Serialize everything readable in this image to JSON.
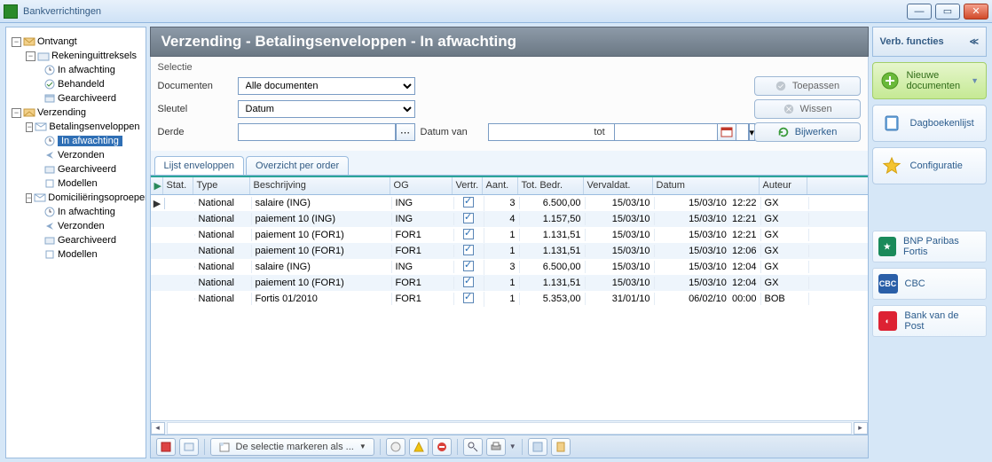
{
  "window": {
    "title": "Bankverrichtingen"
  },
  "tree": {
    "root1": {
      "label": "Ontvangt"
    },
    "r1_c1": {
      "label": "Rekeninguittreksels"
    },
    "r1_c1_a": {
      "label": "In afwachting"
    },
    "r1_c1_b": {
      "label": "Behandeld"
    },
    "r1_c1_c": {
      "label": "Gearchiveerd"
    },
    "root2": {
      "label": "Verzending"
    },
    "r2_c1": {
      "label": "Betalingsenveloppen"
    },
    "r2_c1_a": {
      "label": "In afwachting"
    },
    "r2_c1_b": {
      "label": "Verzonden"
    },
    "r2_c1_c": {
      "label": "Gearchiveerd"
    },
    "r2_c1_d": {
      "label": "Modellen"
    },
    "r2_c2": {
      "label": "Domiciliëringsoproepen"
    },
    "r2_c2_a": {
      "label": "In afwachting"
    },
    "r2_c2_b": {
      "label": "Verzonden"
    },
    "r2_c2_c": {
      "label": "Gearchiveerd"
    },
    "r2_c2_d": {
      "label": "Modellen"
    }
  },
  "header": {
    "title": "Verzending - Betalingsenveloppen - In afwachting"
  },
  "filters": {
    "section": "Selectie",
    "docLabel": "Documenten",
    "docValue": "Alle documenten",
    "keyLabel": "Sleutel",
    "keyValue": "Datum",
    "thirdLabel": "Derde",
    "dateFromLabel": "Datum van",
    "dateToLabel": "tot",
    "apply": "Toepassen",
    "clear": "Wissen",
    "refresh": "Bijwerken"
  },
  "tabs": {
    "t1": "Lijst enveloppen",
    "t2": "Overzicht per order"
  },
  "gridHead": {
    "stat": "Stat.",
    "type": "Type",
    "desc": "Beschrijving",
    "og": "OG",
    "vertr": "Vertr.",
    "aant": "Aant.",
    "bedr": "Tot. Bedr.",
    "verval": "Vervaldat.",
    "datum": "Datum",
    "auteur": "Auteur"
  },
  "rows": [
    {
      "type": "National",
      "desc": "salaire (ING)",
      "og": "ING",
      "aant": "3",
      "bedr": "6.500,00",
      "verval": "15/03/10",
      "datum": "15/03/10",
      "tijd": "12:22",
      "auteur": "GX"
    },
    {
      "type": "National",
      "desc": "paiement 10 (ING)",
      "og": "ING",
      "aant": "4",
      "bedr": "1.157,50",
      "verval": "15/03/10",
      "datum": "15/03/10",
      "tijd": "12:21",
      "auteur": "GX"
    },
    {
      "type": "National",
      "desc": "paiement 10 (FOR1)",
      "og": "FOR1",
      "aant": "1",
      "bedr": "1.131,51",
      "verval": "15/03/10",
      "datum": "15/03/10",
      "tijd": "12:21",
      "auteur": "GX"
    },
    {
      "type": "National",
      "desc": "paiement 10 (FOR1)",
      "og": "FOR1",
      "aant": "1",
      "bedr": "1.131,51",
      "verval": "15/03/10",
      "datum": "15/03/10",
      "tijd": "12:06",
      "auteur": "GX"
    },
    {
      "type": "National",
      "desc": "salaire (ING)",
      "og": "ING",
      "aant": "3",
      "bedr": "6.500,00",
      "verval": "15/03/10",
      "datum": "15/03/10",
      "tijd": "12:04",
      "auteur": "GX"
    },
    {
      "type": "National",
      "desc": "paiement 10 (FOR1)",
      "og": "FOR1",
      "aant": "1",
      "bedr": "1.131,51",
      "verval": "15/03/10",
      "datum": "15/03/10",
      "tijd": "12:04",
      "auteur": "GX"
    },
    {
      "type": "National",
      "desc": "Fortis 01/2010",
      "og": "FOR1",
      "aant": "1",
      "bedr": "5.353,00",
      "verval": "31/01/10",
      "datum": "06/02/10",
      "tijd": "00:00",
      "auteur": "BOB"
    }
  ],
  "toolbar": {
    "markAs": "De selectie markeren als ..."
  },
  "right": {
    "header": "Verb. functies",
    "new": "Nieuwe documenten",
    "journals": "Dagboekenlijst",
    "config": "Configuratie",
    "bank1": "BNP Paribas Fortis",
    "bank2": "CBC",
    "bank3": "Bank van de Post"
  }
}
